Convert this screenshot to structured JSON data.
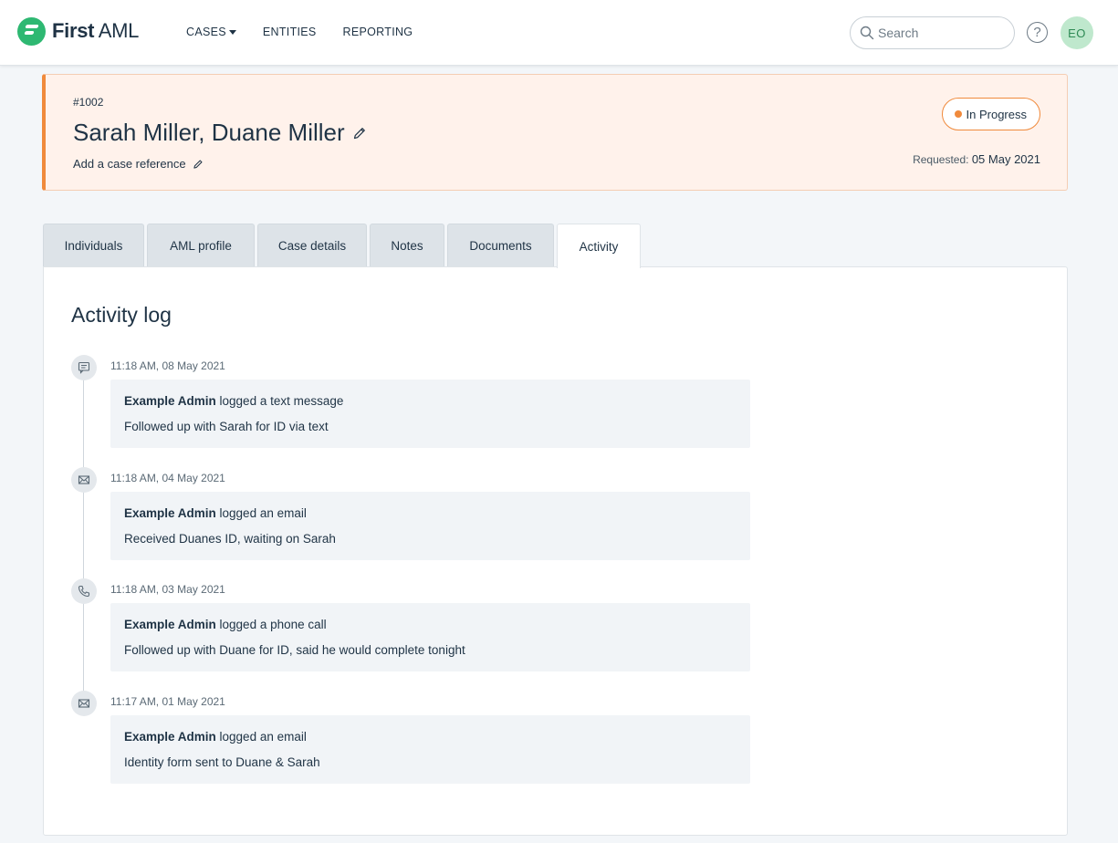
{
  "app": {
    "brand_first": "First",
    "brand_second": " AML"
  },
  "nav": {
    "items": [
      {
        "label": "CASES",
        "has_dropdown": true
      },
      {
        "label": "ENTITIES"
      },
      {
        "label": "REPORTING"
      }
    ]
  },
  "search": {
    "placeholder": "Search"
  },
  "help": {
    "label": "?"
  },
  "user": {
    "initials": "EO"
  },
  "case": {
    "id": "#1002",
    "title": "Sarah Miller, Duane Miller",
    "reference_prompt": "Add a case reference",
    "status": "In Progress",
    "requested_label": "Requested:",
    "requested_date": "05 May 2021"
  },
  "tabs": [
    {
      "label": "Individuals"
    },
    {
      "label": "AML profile"
    },
    {
      "label": "Case details"
    },
    {
      "label": "Notes"
    },
    {
      "label": "Documents"
    },
    {
      "label": "Activity",
      "active": true
    }
  ],
  "activity": {
    "title": "Activity log",
    "entries": [
      {
        "icon": "message-icon",
        "time": "11:18 AM, 08 May 2021",
        "actor": "Example Admin",
        "action": " logged a text message",
        "detail": "Followed up with Sarah for ID via text"
      },
      {
        "icon": "email-icon",
        "time": "11:18 AM, 04 May 2021",
        "actor": "Example Admin",
        "action": " logged an email",
        "detail": "Received Duanes ID, waiting on Sarah"
      },
      {
        "icon": "phone-icon",
        "time": "11:18 AM, 03 May 2021",
        "actor": "Example Admin",
        "action": " logged a phone call",
        "detail": "Followed up with Duane for ID, said he would complete tonight"
      },
      {
        "icon": "email-icon",
        "time": "11:17 AM, 01 May 2021",
        "actor": "Example Admin",
        "action": " logged an email",
        "detail": "Identity form sent to Duane & Sarah"
      }
    ]
  },
  "colors": {
    "accent_orange": "#f08a3c",
    "brand_green": "#2eb872",
    "header_bg": "#fff2eb"
  }
}
